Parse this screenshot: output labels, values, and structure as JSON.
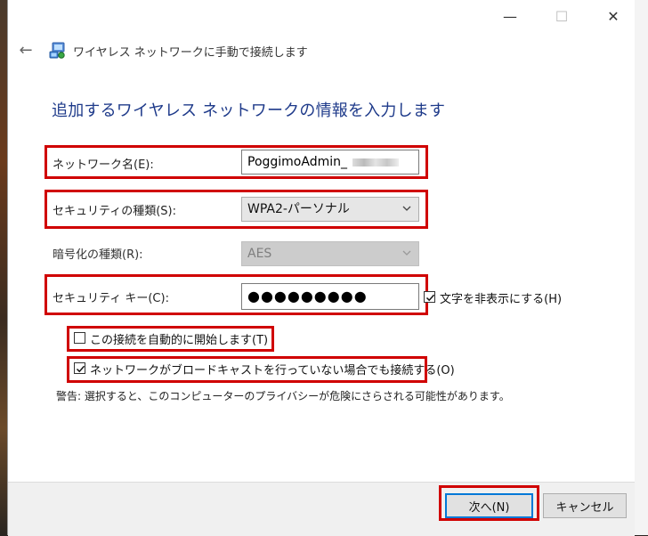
{
  "window": {
    "minimize_glyph": "—",
    "maximize_glyph": "☐",
    "close_glyph": "✕"
  },
  "nav": {
    "back_glyph": "←",
    "title": "ワイヤレス ネットワークに手動で接続します",
    "icon": "network-icon"
  },
  "heading": "追加するワイヤレス ネットワークの情報を入力します",
  "form": {
    "network_name_label": "ネットワーク名(E):",
    "network_name_value": "PoggimoAdmin_",
    "security_type_label": "セキュリティの種類(S):",
    "security_type_value": "WPA2-パーソナル",
    "encryption_type_label": "暗号化の種類(R):",
    "encryption_type_value": "AES",
    "security_key_label": "セキュリティ キー(C):",
    "security_key_value": "●●●●●●●●●",
    "hide_chars_label": "文字を非表示にする(H)",
    "hide_chars_checked": true
  },
  "options": {
    "auto_start_label": "この接続を自動的に開始します(T)",
    "auto_start_checked": false,
    "connect_hidden_label": "ネットワークがブロードキャストを行っていない場合でも接続する(O)",
    "connect_hidden_checked": true,
    "warning": "警告: 選択すると、このコンピューターのプライバシーが危険にさらされる可能性があります。"
  },
  "buttons": {
    "next": "次へ(N)",
    "cancel": "キャンセル"
  },
  "colors": {
    "highlight": "#d00000",
    "heading": "#1e3a8a",
    "primary_border": "#0078d7"
  }
}
